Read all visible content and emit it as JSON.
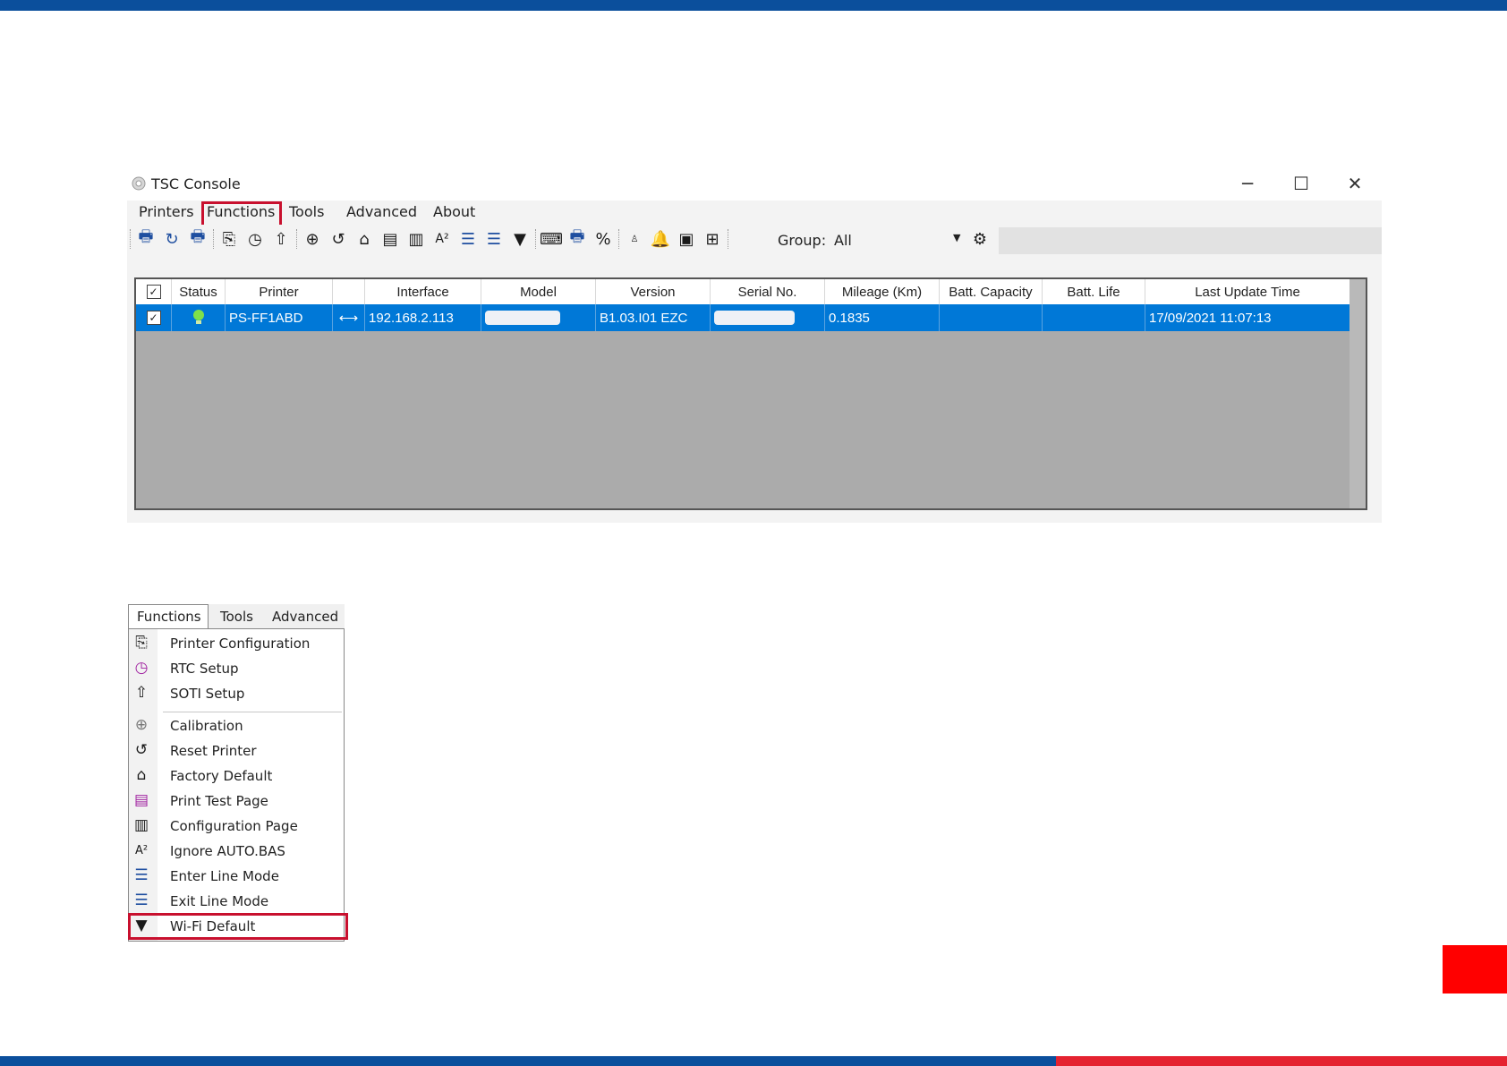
{
  "window": {
    "title": "TSC Console",
    "controls": {
      "minimize": "─",
      "maximize": "☐",
      "close": "✕"
    }
  },
  "menubar": {
    "items": [
      "Printers",
      "Functions",
      "Tools",
      "Advanced",
      "About"
    ],
    "highlighted": "Functions"
  },
  "toolbar": {
    "group_label": "Group:",
    "group_value": "All",
    "icons": [
      "printer-add-icon",
      "refresh-icon",
      "printer-remove-icon",
      "printer-config-icon",
      "clock-icon",
      "cloud-upload-icon",
      "calibration-icon",
      "reset-icon",
      "home-icon",
      "test-page-icon",
      "config-page-icon",
      "ignore-autobas-icon",
      "enter-line-mode-icon",
      "exit-line-mode-icon",
      "wifi-icon",
      "command-icon",
      "printer-send-icon",
      "percent-icon",
      "small-person-icon",
      "bell-icon",
      "image-icon",
      "chip-icon",
      "gear-icon"
    ]
  },
  "grid": {
    "columns": [
      "",
      "Status",
      "Printer",
      "",
      "Interface",
      "Model",
      "Version",
      "Serial No.",
      "Mileage (Km)",
      "Batt. Capacity",
      "Batt. Life",
      "Last Update Time"
    ],
    "rows": [
      {
        "checked": true,
        "status": "online",
        "printer": "PS-FF1ABD",
        "interface": "192.168.2.113",
        "model": "",
        "version": "B1.03.I01 EZC",
        "serial": "",
        "mileage": "0.1835",
        "batt_capacity": "",
        "batt_life": "",
        "last_update": "17/09/2021 11:07:13"
      }
    ]
  },
  "dropdown": {
    "menubar": [
      "Functions",
      "Tools",
      "Advanced"
    ],
    "items": [
      {
        "label": "Printer Configuration",
        "icon": "printer-config-icon"
      },
      {
        "label": "RTC Setup",
        "icon": "clock-icon"
      },
      {
        "label": "SOTI Setup",
        "icon": "cloud-upload-icon"
      },
      {
        "label": "Calibration",
        "icon": "calibration-icon"
      },
      {
        "label": "Reset Printer",
        "icon": "reset-icon"
      },
      {
        "label": "Factory Default",
        "icon": "home-icon"
      },
      {
        "label": "Print Test Page",
        "icon": "test-page-icon"
      },
      {
        "label": "Configuration Page",
        "icon": "config-page-icon"
      },
      {
        "label": "Ignore AUTO.BAS",
        "icon": "ignore-autobas-icon"
      },
      {
        "label": "Enter Line Mode",
        "icon": "enter-line-mode-icon"
      },
      {
        "label": "Exit Line Mode",
        "icon": "exit-line-mode-icon"
      },
      {
        "label": "Wi-Fi Default",
        "icon": "wifi-icon"
      }
    ],
    "highlighted": "Wi-Fi Default"
  },
  "colors": {
    "accent_blue": "#0b4f9c",
    "accent_red": "#e52330",
    "highlight_red": "#c8102e",
    "selection_blue": "#0078d7"
  }
}
